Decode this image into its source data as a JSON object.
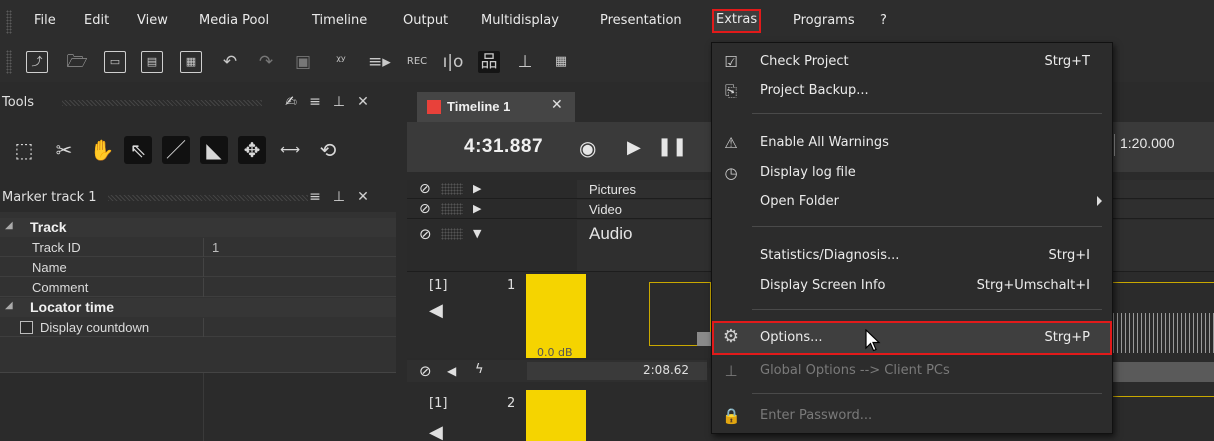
{
  "menubar": {
    "items": [
      "File",
      "Edit",
      "View",
      "Media Pool",
      "Timeline",
      "Output",
      "Multidisplay",
      "Presentation",
      "Extras",
      "Programs",
      "?"
    ],
    "active": "Extras"
  },
  "tools_panel": {
    "title": "Tools"
  },
  "marker_panel": {
    "title": "Marker track 1",
    "categories": [
      {
        "name": "Track",
        "rows": [
          {
            "name": "Track ID",
            "value": "1"
          },
          {
            "name": "Name",
            "value": ""
          },
          {
            "name": "Comment",
            "value": ""
          }
        ]
      },
      {
        "name": "Locator time",
        "rows": [
          {
            "name": "Display countdown",
            "checkbox": true,
            "checked": false
          }
        ]
      }
    ]
  },
  "timeline": {
    "tab_label": "Timeline 1",
    "time": "4:31.887",
    "ruler_label": "1:20.000",
    "tracks": [
      {
        "name": "Pictures"
      },
      {
        "name": "Video"
      },
      {
        "name": "Audio"
      }
    ],
    "audio_channel_1": {
      "route": "[1]",
      "number": "1",
      "level": "0.0 dB",
      "clip_time": "2:08.62"
    },
    "audio_channel_2": {
      "route": "[1]",
      "number": "2"
    }
  },
  "extras_menu": {
    "items": [
      {
        "label": "Check Project",
        "shortcut": "Strg+T",
        "icon": "check-project-icon"
      },
      {
        "label": "Project Backup...",
        "shortcut": "",
        "icon": "backup-icon"
      },
      {
        "label": "Enable All Warnings",
        "shortcut": "",
        "icon": "warning-icon"
      },
      {
        "label": "Display log file",
        "shortcut": "",
        "icon": "log-file-icon"
      },
      {
        "label": "Open Folder",
        "shortcut": "",
        "icon": ""
      },
      {
        "label": "Statistics/Diagnosis...",
        "shortcut": "Strg+I",
        "icon": ""
      },
      {
        "label": "Display Screen Info",
        "shortcut": "Strg+Umschalt+I",
        "icon": ""
      },
      {
        "label": "Options...",
        "shortcut": "Strg+P",
        "icon": "gear-icon"
      },
      {
        "label": "Global Options --> Client PCs",
        "shortcut": "",
        "icon": "network-icon"
      },
      {
        "label": "Enter Password...",
        "shortcut": "",
        "icon": "lock-icon"
      }
    ]
  },
  "colors": {
    "highlight_outline": "#e21a1a",
    "audio_level": "#f5d400",
    "timeline_tab_marker": "#e8413a"
  }
}
